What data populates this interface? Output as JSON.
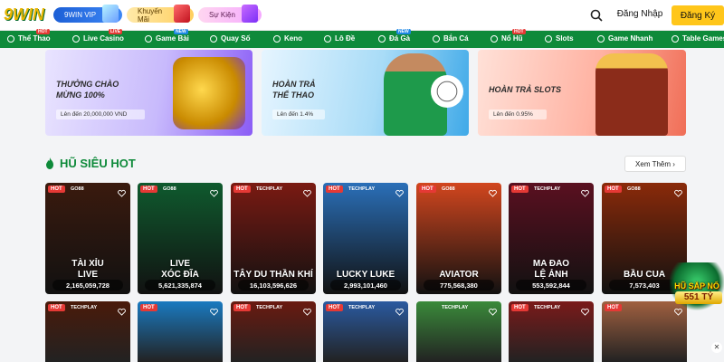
{
  "header": {
    "logo": "9WIN",
    "promo_pills": [
      "9WIN VIP",
      "Khuyến Mãi",
      "Sự Kiện"
    ],
    "login": "Đăng Nhập",
    "signup": "Đăng Ký"
  },
  "nav": [
    {
      "label": "Thể Thao",
      "tag": "HOT"
    },
    {
      "label": "Live Casino",
      "tag": "LIVE"
    },
    {
      "label": "Game Bài",
      "tag": "NEW"
    },
    {
      "label": "Quay Số",
      "tag": ""
    },
    {
      "label": "Keno",
      "tag": ""
    },
    {
      "label": "Lô Đề",
      "tag": ""
    },
    {
      "label": "Đá Gà",
      "tag": "NEW"
    },
    {
      "label": "Bắn Cá",
      "tag": ""
    },
    {
      "label": "Nổ Hũ",
      "tag": "HOT"
    },
    {
      "label": "Slots",
      "tag": ""
    },
    {
      "label": "Game Nhanh",
      "tag": ""
    },
    {
      "label": "Table Games",
      "tag": ""
    }
  ],
  "banners": [
    {
      "title_line1": "THƯỞNG CHÀO",
      "title_line2": "MỪNG 100%",
      "sub": "Lên đến 20,000,000 VND"
    },
    {
      "title_line1": "HOÀN TRẢ",
      "title_line2": "THỂ THAO",
      "sub": "Lên đến 1.4%"
    },
    {
      "title_line1": "HOÀN TRẢ SLOTS",
      "title_line2": "",
      "sub": "Lên đến 0.95%"
    }
  ],
  "section": {
    "title": "HŨ SIÊU HOT",
    "more": "Xem Thêm"
  },
  "games": [
    {
      "tag": "HOT",
      "provider": "GO88",
      "name1": "TÀI XỈU",
      "name2": "LIVE",
      "jackpot": "2,165,059,728",
      "color": "#3a1a0e"
    },
    {
      "tag": "HOT",
      "provider": "GO88",
      "name1": "LIVE",
      "name2": "XÓC ĐĨA",
      "jackpot": "5,621,335,874",
      "color": "#0f5a2e"
    },
    {
      "tag": "HOT",
      "provider": "TECHPLAY",
      "name1": "TÂY DU THẦN KHÍ",
      "name2": "",
      "jackpot": "16,103,596,626",
      "color": "#7a1a12"
    },
    {
      "tag": "HOT",
      "provider": "TECHPLAY",
      "name1": "LUCKY LUKE",
      "name2": "",
      "jackpot": "2,993,101,460",
      "color": "#2a6fb8"
    },
    {
      "tag": "HOT",
      "provider": "GO88",
      "name1": "AVIATOR",
      "name2": "",
      "jackpot": "775,568,380",
      "color": "#d2461e"
    },
    {
      "tag": "HOT",
      "provider": "TECHPLAY",
      "name1": "MA ĐAO",
      "name2": "LỆ ẢNH",
      "jackpot": "553,592,844",
      "color": "#5a1020"
    },
    {
      "tag": "HOT",
      "provider": "GO88",
      "name1": "BẦU CUA",
      "name2": "",
      "jackpot": "7,573,403",
      "color": "#8a2a0a"
    }
  ],
  "games_row2": [
    {
      "tag": "HOT",
      "provider": "TECHPLAY",
      "color": "#4a1a0a"
    },
    {
      "tag": "HOT",
      "provider": "",
      "color": "#1a7ac0"
    },
    {
      "tag": "HOT",
      "provider": "TECHPLAY",
      "color": "#6a1a10"
    },
    {
      "tag": "HOT",
      "provider": "TECHPLAY",
      "color": "#2a5aa0"
    },
    {
      "tag": "",
      "provider": "TECHPLAY",
      "color": "#3a8a3a"
    },
    {
      "tag": "HOT",
      "provider": "TECHPLAY",
      "color": "#7a1a1a"
    },
    {
      "tag": "HOT",
      "provider": "",
      "color": "#a06040"
    }
  ],
  "floater": {
    "line1": "HŨ SẮP NỔ",
    "amount": "551 TỶ"
  }
}
